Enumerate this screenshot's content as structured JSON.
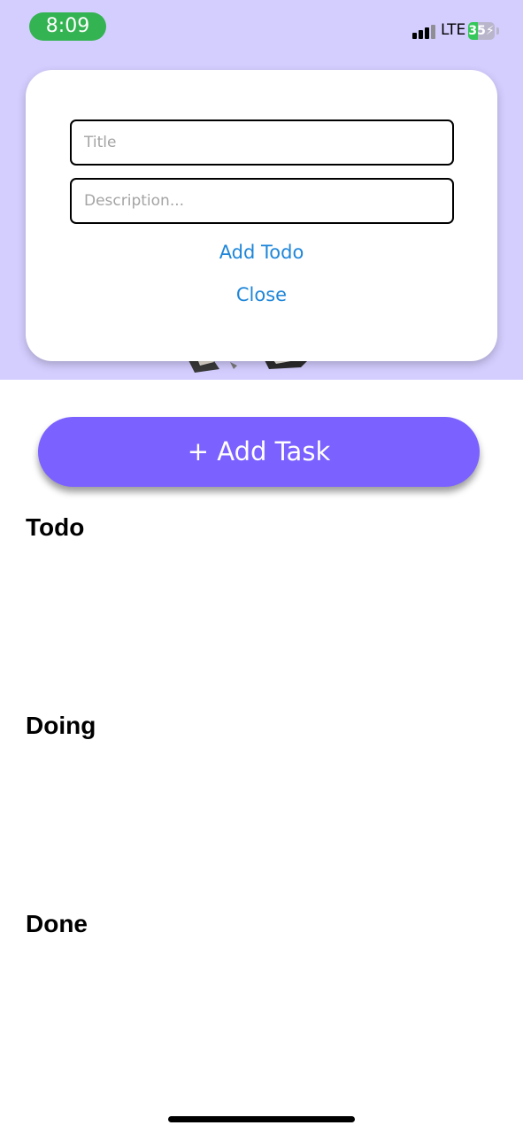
{
  "status_bar": {
    "time": "8:09",
    "network": "LTE",
    "battery_level": "35",
    "battery_charging": true,
    "battery_color": "#34c759",
    "time_pill_color": "#34b352"
  },
  "modal": {
    "title_placeholder": "Title",
    "description_placeholder": "Description...",
    "title_value": "",
    "description_value": "",
    "add_button_label": "Add Todo",
    "close_button_label": "Close",
    "link_color": "#1f86d9"
  },
  "main": {
    "add_task_label": "+ Add Task",
    "add_task_color": "#7b61ff",
    "header_background": "#d4ceff",
    "sections": [
      {
        "title": "Todo"
      },
      {
        "title": "Doing"
      },
      {
        "title": "Done"
      }
    ]
  }
}
